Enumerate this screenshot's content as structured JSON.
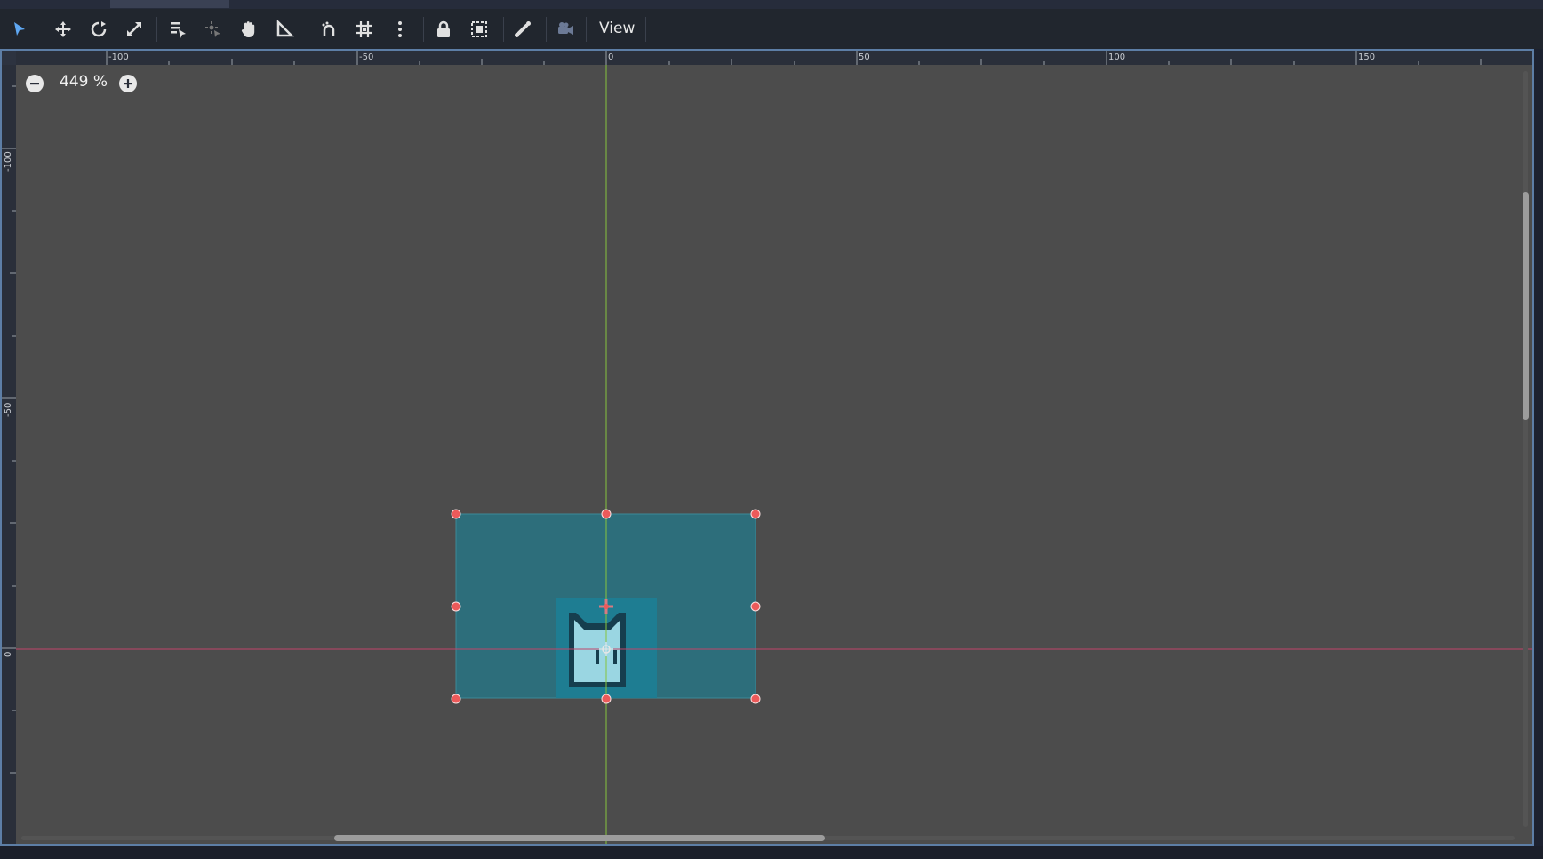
{
  "toolbar": {
    "tools": [
      {
        "name": "select-tool",
        "icon": "select-arrow-icon",
        "active": true
      },
      {
        "name": "move-tool",
        "icon": "move-icon"
      },
      {
        "name": "rotate-tool",
        "icon": "rotate-icon"
      },
      {
        "name": "scale-tool",
        "icon": "scale-icon"
      },
      {
        "name": "list-select-tool",
        "icon": "list-select-icon"
      },
      {
        "name": "pivot-tool",
        "icon": "pivot-icon",
        "disabled": true
      },
      {
        "name": "pan-tool",
        "icon": "hand-icon"
      },
      {
        "name": "ruler-tool",
        "icon": "ruler-icon"
      },
      {
        "name": "smart-snap-toggle",
        "icon": "smart-snap-icon"
      },
      {
        "name": "grid-snap-toggle",
        "icon": "grid-snap-icon"
      },
      {
        "name": "snap-options-menu",
        "icon": "kebab-menu-icon"
      },
      {
        "name": "lock-button",
        "icon": "lock-icon"
      },
      {
        "name": "group-button",
        "icon": "group-icon"
      },
      {
        "name": "bone-button",
        "icon": "bone-icon"
      },
      {
        "name": "camera-override-button",
        "icon": "camera-icon",
        "disabled": true
      }
    ],
    "view_label": "View"
  },
  "zoom": {
    "value_label": "449 %",
    "zoom_out_icon": "zoom-out-icon",
    "zoom_in_icon": "zoom-in-icon"
  },
  "rulers": {
    "horizontal_labels": [
      "-100",
      "-50",
      "0",
      "50",
      "100",
      "150"
    ],
    "vertical_labels": [
      "-100",
      "-50",
      "0"
    ]
  },
  "colors": {
    "viewport_bg": "#4c4c4c",
    "x_axis": "#c0456a",
    "y_axis": "#86c43e",
    "selection_fill": "#2d6e7b",
    "handle": "#ec5a5a",
    "sprite_light": "#9ad6e2",
    "sprite_dark": "#163e4e",
    "sprite_bg": "#1e7d92"
  }
}
